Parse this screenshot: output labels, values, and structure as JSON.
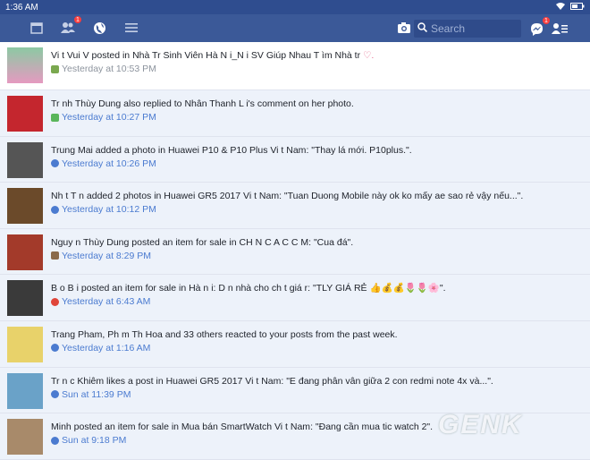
{
  "status": {
    "time": "1:36 AM"
  },
  "nav": {
    "friend_badge": "1",
    "messenger_badge": "1",
    "search_placeholder": "Search"
  },
  "notifications": [
    {
      "actor": "Vi t Vui V",
      "action": " posted in ",
      "target": "Nhà Tr  Sinh Viên Hà N i_N i SV Giúp Nhau T ìm Nhà tr",
      "extra": " ♡.",
      "time": "Yesterday at 10:53 PM",
      "meta_icon": "group-icon",
      "avatar_color": "#d97aa7"
    },
    {
      "actor": "Tr nh Thùy Dung",
      "action": " also replied to ",
      "target": "Nhân Thanh L",
      "extra": " i's comment on her photo.",
      "time": "Yesterday at 10:27 PM",
      "meta_icon": "comment-icon",
      "avatar_color": "#c4262e"
    },
    {
      "actor": "Trung Mai",
      "action": " added a photo in ",
      "target": "Huawei P10 & P10 Plus Vi t Nam",
      "extra": ": \"Thay lá mới. P10plus.\".",
      "time": "Yesterday at 10:26 PM",
      "meta_icon": "globe-icon",
      "avatar_color": "#555"
    },
    {
      "actor": "Nh t T n",
      "action": " added 2 photos in ",
      "target": "Huawei GR5 2017 Vi t Nam",
      "extra": ": \"Tuan Duong Mobile này ok ko mấy ae sao rẻ vậy nếu...\".",
      "time": "Yesterday at 10:12 PM",
      "meta_icon": "globe-icon",
      "avatar_color": "#6b4a2a"
    },
    {
      "actor": "Nguy n Thùy Dung",
      "action": " posted an item for sale in ",
      "target": "CH     N C  A C  C M",
      "extra": ": \"Cua đá\".",
      "time": "Yesterday at 8:29 PM",
      "meta_icon": "coffee-icon",
      "avatar_color": "#a33a2a"
    },
    {
      "actor": "B o B i",
      "action": " posted an item for sale in ",
      "target": "Hà n i: D n nhà cho     ch t giá r",
      "extra": ": \"TLY GIÁ RẺ 👍💰💰🌷🌷🌸\".",
      "time": "Yesterday at 6:43 AM",
      "meta_icon": "apple-icon",
      "avatar_color": "#3a3a3a"
    },
    {
      "actor": "Trang Pham, Ph m Th   Hoa",
      "action": " and 33 others reacted to your posts from the past week.",
      "target": "",
      "extra": "",
      "time": "Yesterday at 1:16 AM",
      "meta_icon": "globe-icon",
      "avatar_color": "#e8d26a"
    },
    {
      "actor": "Tr n   c Khiêm",
      "action": " likes a post in ",
      "target": "Huawei GR5 2017 Vi t Nam",
      "extra": ": \"E đang phân vân giữa 2 con redmi note 4x và...\".",
      "time": "Sun at 11:39 PM",
      "meta_icon": "globe-icon",
      "avatar_color": "#6aa2c8"
    },
    {
      "actor": "   Minh",
      "action": " posted an item for sale in ",
      "target": "Mua bán SmartWatch Vi t Nam",
      "extra": ": \"Đang cần mua tic watch 2\".",
      "time": "Sun at 9:18 PM",
      "meta_icon": "globe-icon",
      "avatar_color": "#a88a6a"
    }
  ],
  "watermark": "GENK"
}
